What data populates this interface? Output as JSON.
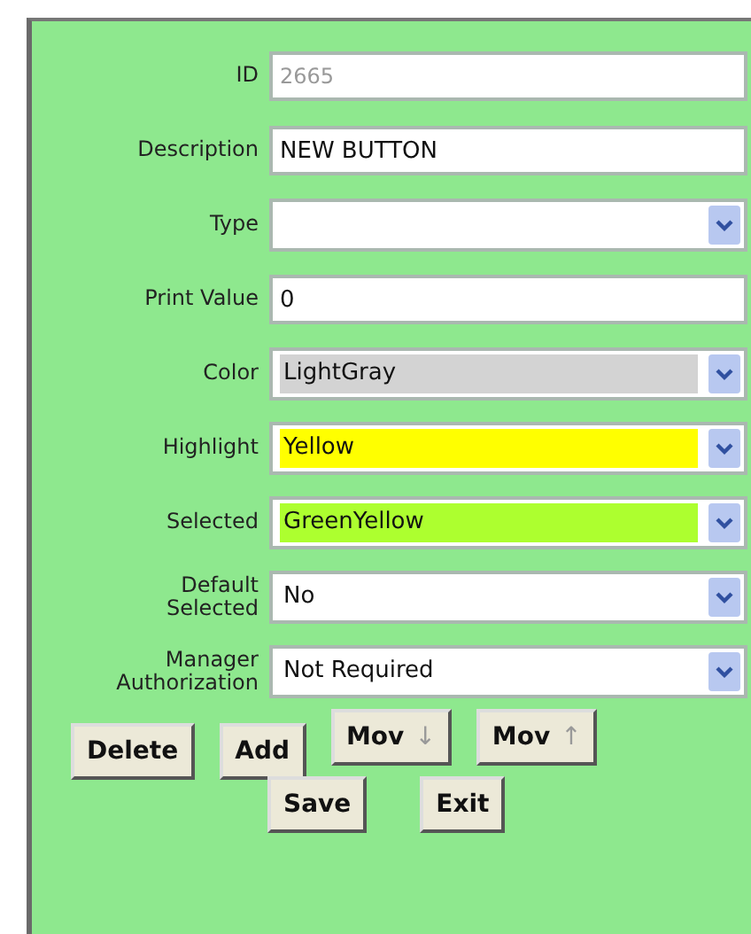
{
  "fields": [
    {
      "label": "ID",
      "kind": "text",
      "value": "2665",
      "disabled": true
    },
    {
      "label": "Description",
      "kind": "text",
      "value": "NEW BUTTON",
      "disabled": false
    },
    {
      "label": "Type",
      "kind": "dropdown"
    },
    {
      "label": "Print Value",
      "kind": "text",
      "value": "0",
      "disabled": false
    },
    {
      "label": "Color",
      "kind": "dropdown",
      "value": "LightGray",
      "color": "#d3d3d3"
    },
    {
      "label": "Highlight",
      "kind": "dropdown",
      "value": "Yellow",
      "color": "#ffff00"
    },
    {
      "label": "Selected",
      "kind": "dropdown",
      "value": "GreenYellow",
      "color": "#adff2f"
    },
    {
      "label": "Default Selected",
      "kind": "dropdown",
      "value": "No",
      "color": "#ffffff"
    },
    {
      "label": "Manager Authorization",
      "kind": "dropdown",
      "value": "Not Required",
      "color": "#ffffff"
    }
  ],
  "button_rows": [
    [
      {
        "label": "Delete"
      },
      {
        "label": "Add"
      },
      {
        "label": "Mov",
        "arrow": "↓"
      },
      {
        "label": "Mov",
        "arrow": "↑"
      }
    ],
    [
      {
        "label": "Save"
      },
      {
        "label": "Exit"
      }
    ]
  ]
}
